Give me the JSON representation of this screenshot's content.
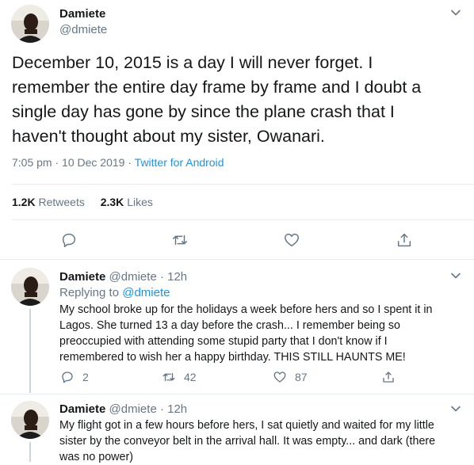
{
  "main_tweet": {
    "display_name": "Damiete",
    "handle": "@dmiete",
    "text_lines": [
      "December 10, 2015 is a day I will never forget. I",
      "remember the entire day frame by frame and I doubt a",
      "single day has gone by since the plane crash that I",
      "haven't thought about my sister, Owanari."
    ],
    "time": "7:05 pm",
    "separator": "·",
    "date": "10 Dec 2019",
    "source": "Twitter for Android",
    "retweets_count": "1.2K",
    "retweets_label": "Retweets",
    "likes_count": "2.3K",
    "likes_label": "Likes"
  },
  "replies": [
    {
      "display_name": "Damiete",
      "handle": "@dmiete",
      "time_ago": "· 12h",
      "replying_prefix": "Replying to",
      "replying_handle": "@dmiete",
      "text_lines": [
        "My school broke up for the holidays a week before hers and so I spent it in",
        "Lagos. She turned 13  a day before the crash... I remember being so",
        "preoccupied with attending some stupid party that I don't know if I",
        "remembered to wish her a happy birthday.  THIS STILL HAUNTS ME!"
      ],
      "reply_count": "2",
      "retweet_count": "42",
      "like_count": "87"
    },
    {
      "display_name": "Damiete",
      "handle": "@dmiete",
      "time_ago": "· 12h",
      "text_lines": [
        "My flight got in a few hours before hers, I sat quietly and waited for my little",
        "sister by the conveyor belt in the arrival hall. It was empty... and dark (there",
        "was no power)"
      ]
    }
  ],
  "icons": {
    "more": "chevron-down-icon",
    "reply": "reply-icon",
    "retweet": "retweet-icon",
    "like": "heart-icon",
    "share": "share-icon"
  },
  "colors": {
    "text": "#14171a",
    "muted": "#657786",
    "link": "#1b95e0",
    "divider": "#e6ecf0"
  }
}
